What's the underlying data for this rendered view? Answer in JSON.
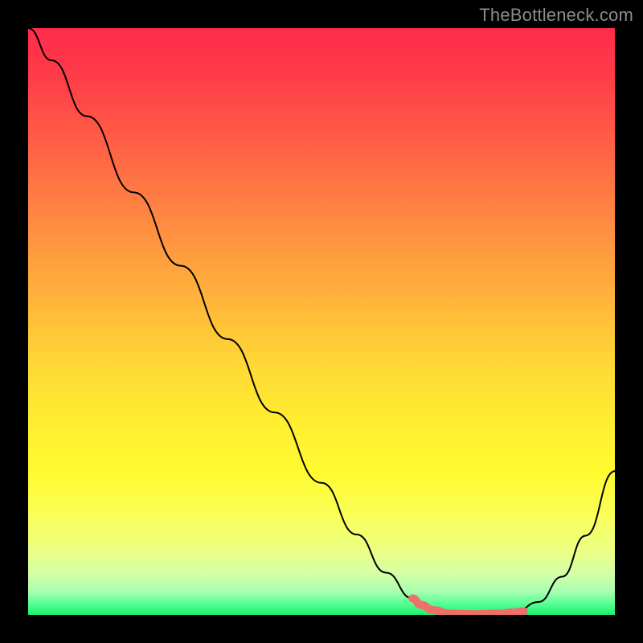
{
  "watermark": {
    "text": "TheBottleneck.com"
  },
  "colors": {
    "curve": "#000000",
    "highlight": "#ef6f6a",
    "background_top": "#ff2b4b",
    "background_bottom": "#17f46e"
  },
  "chart_data": {
    "type": "line",
    "title": "",
    "xlabel": "",
    "ylabel": "",
    "xlim": [
      0,
      1
    ],
    "ylim": [
      0,
      1
    ],
    "grid": false,
    "legend": false,
    "series": [
      {
        "name": "bottleneck-curve",
        "x": [
          0.0,
          0.04,
          0.1,
          0.18,
          0.26,
          0.34,
          0.42,
          0.5,
          0.56,
          0.61,
          0.655,
          0.69,
          0.72,
          0.76,
          0.8,
          0.83,
          0.87,
          0.91,
          0.95,
          1.0
        ],
        "y": [
          1.0,
          0.945,
          0.85,
          0.72,
          0.595,
          0.47,
          0.345,
          0.225,
          0.137,
          0.072,
          0.028,
          0.008,
          0.002,
          0.001,
          0.002,
          0.005,
          0.022,
          0.065,
          0.135,
          0.245
        ]
      }
    ],
    "annotations": [
      {
        "name": "valley-highlight",
        "x": [
          0.655,
          0.67,
          0.69,
          0.72,
          0.76,
          0.8,
          0.825,
          0.845
        ],
        "y": [
          0.028,
          0.017,
          0.008,
          0.002,
          0.001,
          0.002,
          0.004,
          0.006
        ]
      }
    ]
  }
}
